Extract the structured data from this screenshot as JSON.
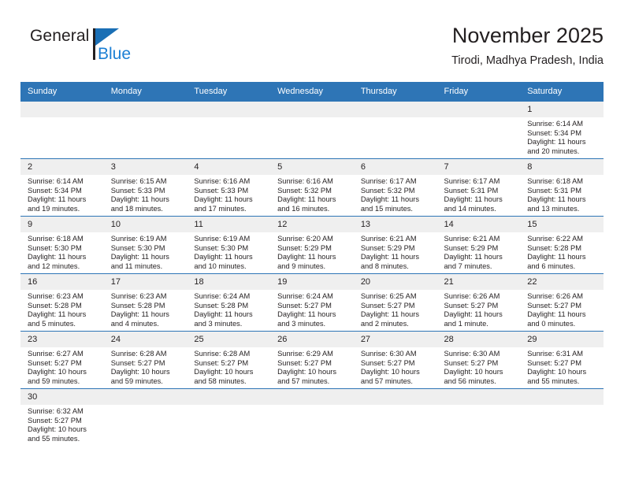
{
  "brand": {
    "name_part1": "General",
    "name_part2": "Blue",
    "flag_color": "#1a6fb5",
    "blue_color": "#1b7fd4"
  },
  "header": {
    "title": "November 2025",
    "subtitle": "Tirodi, Madhya Pradesh, India"
  },
  "theme": {
    "header_bg": "#2e75b6",
    "daynum_bg": "#efefef",
    "text": "#231f20"
  },
  "weekdays": [
    "Sunday",
    "Monday",
    "Tuesday",
    "Wednesday",
    "Thursday",
    "Friday",
    "Saturday"
  ],
  "labels": {
    "sunrise": "Sunrise:",
    "sunset": "Sunset:",
    "daylight": "Daylight:"
  },
  "weeks": [
    [
      {
        "day": "",
        "empty": true
      },
      {
        "day": "",
        "empty": true
      },
      {
        "day": "",
        "empty": true
      },
      {
        "day": "",
        "empty": true
      },
      {
        "day": "",
        "empty": true
      },
      {
        "day": "",
        "empty": true
      },
      {
        "day": "1",
        "sunrise": "Sunrise: 6:14 AM",
        "sunset": "Sunset: 5:34 PM",
        "daylight_line1": "Daylight: 11 hours",
        "daylight_line2": "and 20 minutes."
      }
    ],
    [
      {
        "day": "2",
        "sunrise": "Sunrise: 6:14 AM",
        "sunset": "Sunset: 5:34 PM",
        "daylight_line1": "Daylight: 11 hours",
        "daylight_line2": "and 19 minutes."
      },
      {
        "day": "3",
        "sunrise": "Sunrise: 6:15 AM",
        "sunset": "Sunset: 5:33 PM",
        "daylight_line1": "Daylight: 11 hours",
        "daylight_line2": "and 18 minutes."
      },
      {
        "day": "4",
        "sunrise": "Sunrise: 6:16 AM",
        "sunset": "Sunset: 5:33 PM",
        "daylight_line1": "Daylight: 11 hours",
        "daylight_line2": "and 17 minutes."
      },
      {
        "day": "5",
        "sunrise": "Sunrise: 6:16 AM",
        "sunset": "Sunset: 5:32 PM",
        "daylight_line1": "Daylight: 11 hours",
        "daylight_line2": "and 16 minutes."
      },
      {
        "day": "6",
        "sunrise": "Sunrise: 6:17 AM",
        "sunset": "Sunset: 5:32 PM",
        "daylight_line1": "Daylight: 11 hours",
        "daylight_line2": "and 15 minutes."
      },
      {
        "day": "7",
        "sunrise": "Sunrise: 6:17 AM",
        "sunset": "Sunset: 5:31 PM",
        "daylight_line1": "Daylight: 11 hours",
        "daylight_line2": "and 14 minutes."
      },
      {
        "day": "8",
        "sunrise": "Sunrise: 6:18 AM",
        "sunset": "Sunset: 5:31 PM",
        "daylight_line1": "Daylight: 11 hours",
        "daylight_line2": "and 13 minutes."
      }
    ],
    [
      {
        "day": "9",
        "sunrise": "Sunrise: 6:18 AM",
        "sunset": "Sunset: 5:30 PM",
        "daylight_line1": "Daylight: 11 hours",
        "daylight_line2": "and 12 minutes."
      },
      {
        "day": "10",
        "sunrise": "Sunrise: 6:19 AM",
        "sunset": "Sunset: 5:30 PM",
        "daylight_line1": "Daylight: 11 hours",
        "daylight_line2": "and 11 minutes."
      },
      {
        "day": "11",
        "sunrise": "Sunrise: 6:19 AM",
        "sunset": "Sunset: 5:30 PM",
        "daylight_line1": "Daylight: 11 hours",
        "daylight_line2": "and 10 minutes."
      },
      {
        "day": "12",
        "sunrise": "Sunrise: 6:20 AM",
        "sunset": "Sunset: 5:29 PM",
        "daylight_line1": "Daylight: 11 hours",
        "daylight_line2": "and 9 minutes."
      },
      {
        "day": "13",
        "sunrise": "Sunrise: 6:21 AM",
        "sunset": "Sunset: 5:29 PM",
        "daylight_line1": "Daylight: 11 hours",
        "daylight_line2": "and 8 minutes."
      },
      {
        "day": "14",
        "sunrise": "Sunrise: 6:21 AM",
        "sunset": "Sunset: 5:29 PM",
        "daylight_line1": "Daylight: 11 hours",
        "daylight_line2": "and 7 minutes."
      },
      {
        "day": "15",
        "sunrise": "Sunrise: 6:22 AM",
        "sunset": "Sunset: 5:28 PM",
        "daylight_line1": "Daylight: 11 hours",
        "daylight_line2": "and 6 minutes."
      }
    ],
    [
      {
        "day": "16",
        "sunrise": "Sunrise: 6:23 AM",
        "sunset": "Sunset: 5:28 PM",
        "daylight_line1": "Daylight: 11 hours",
        "daylight_line2": "and 5 minutes."
      },
      {
        "day": "17",
        "sunrise": "Sunrise: 6:23 AM",
        "sunset": "Sunset: 5:28 PM",
        "daylight_line1": "Daylight: 11 hours",
        "daylight_line2": "and 4 minutes."
      },
      {
        "day": "18",
        "sunrise": "Sunrise: 6:24 AM",
        "sunset": "Sunset: 5:28 PM",
        "daylight_line1": "Daylight: 11 hours",
        "daylight_line2": "and 3 minutes."
      },
      {
        "day": "19",
        "sunrise": "Sunrise: 6:24 AM",
        "sunset": "Sunset: 5:27 PM",
        "daylight_line1": "Daylight: 11 hours",
        "daylight_line2": "and 3 minutes."
      },
      {
        "day": "20",
        "sunrise": "Sunrise: 6:25 AM",
        "sunset": "Sunset: 5:27 PM",
        "daylight_line1": "Daylight: 11 hours",
        "daylight_line2": "and 2 minutes."
      },
      {
        "day": "21",
        "sunrise": "Sunrise: 6:26 AM",
        "sunset": "Sunset: 5:27 PM",
        "daylight_line1": "Daylight: 11 hours",
        "daylight_line2": "and 1 minute."
      },
      {
        "day": "22",
        "sunrise": "Sunrise: 6:26 AM",
        "sunset": "Sunset: 5:27 PM",
        "daylight_line1": "Daylight: 11 hours",
        "daylight_line2": "and 0 minutes."
      }
    ],
    [
      {
        "day": "23",
        "sunrise": "Sunrise: 6:27 AM",
        "sunset": "Sunset: 5:27 PM",
        "daylight_line1": "Daylight: 10 hours",
        "daylight_line2": "and 59 minutes."
      },
      {
        "day": "24",
        "sunrise": "Sunrise: 6:28 AM",
        "sunset": "Sunset: 5:27 PM",
        "daylight_line1": "Daylight: 10 hours",
        "daylight_line2": "and 59 minutes."
      },
      {
        "day": "25",
        "sunrise": "Sunrise: 6:28 AM",
        "sunset": "Sunset: 5:27 PM",
        "daylight_line1": "Daylight: 10 hours",
        "daylight_line2": "and 58 minutes."
      },
      {
        "day": "26",
        "sunrise": "Sunrise: 6:29 AM",
        "sunset": "Sunset: 5:27 PM",
        "daylight_line1": "Daylight: 10 hours",
        "daylight_line2": "and 57 minutes."
      },
      {
        "day": "27",
        "sunrise": "Sunrise: 6:30 AM",
        "sunset": "Sunset: 5:27 PM",
        "daylight_line1": "Daylight: 10 hours",
        "daylight_line2": "and 57 minutes."
      },
      {
        "day": "28",
        "sunrise": "Sunrise: 6:30 AM",
        "sunset": "Sunset: 5:27 PM",
        "daylight_line1": "Daylight: 10 hours",
        "daylight_line2": "and 56 minutes."
      },
      {
        "day": "29",
        "sunrise": "Sunrise: 6:31 AM",
        "sunset": "Sunset: 5:27 PM",
        "daylight_line1": "Daylight: 10 hours",
        "daylight_line2": "and 55 minutes."
      }
    ],
    [
      {
        "day": "30",
        "sunrise": "Sunrise: 6:32 AM",
        "sunset": "Sunset: 5:27 PM",
        "daylight_line1": "Daylight: 10 hours",
        "daylight_line2": "and 55 minutes."
      },
      {
        "day": "",
        "empty": true
      },
      {
        "day": "",
        "empty": true
      },
      {
        "day": "",
        "empty": true
      },
      {
        "day": "",
        "empty": true
      },
      {
        "day": "",
        "empty": true
      },
      {
        "day": "",
        "empty": true
      }
    ]
  ]
}
